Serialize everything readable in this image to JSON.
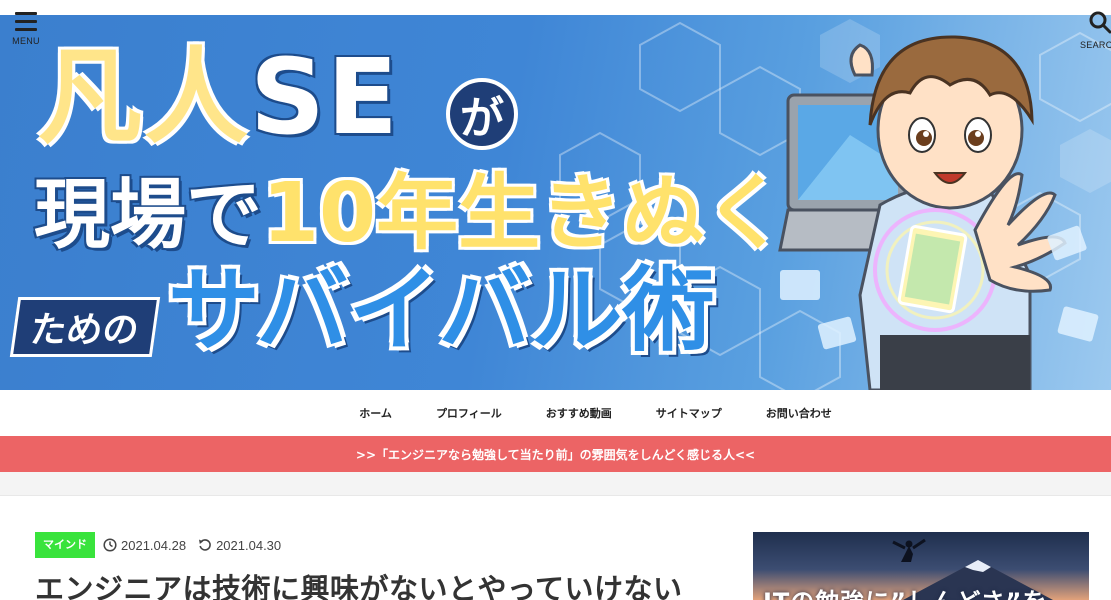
{
  "header": {
    "menu_label": "MENU",
    "search_label": "SEARCH",
    "menu_icon": "hamburger-icon",
    "search_icon": "magnifier-icon"
  },
  "banner": {
    "line1_kanji": "凡人",
    "line1_latin": "SE",
    "line1_particle": "が",
    "line2_white": "現場で",
    "line2_yellow": "10年生きぬく",
    "line3_prefix": "ための",
    "line3_main": "サバイバル術"
  },
  "nav": {
    "items": [
      {
        "label": "ホーム"
      },
      {
        "label": "プロフィール"
      },
      {
        "label": "おすすめ動画"
      },
      {
        "label": "サイトマップ"
      },
      {
        "label": "お問い合わせ"
      }
    ]
  },
  "notice": {
    "text": ">>「エンジニアなら勉強して当たり前」の雰囲気をしんどく感じる人<<"
  },
  "article": {
    "category": "マインド",
    "published": "2021.04.28",
    "updated": "2021.04.30",
    "title": "エンジニアは技術に興味がないとやっていけない"
  },
  "sidebar": {
    "thumb_text": "ITの勉強に”しんどさ”を"
  },
  "colors": {
    "notice_bg": "#ec6465",
    "category_bg": "#39e33c",
    "banner_blue": "#3b7fce",
    "banner_yellow": "#ffe58a"
  }
}
